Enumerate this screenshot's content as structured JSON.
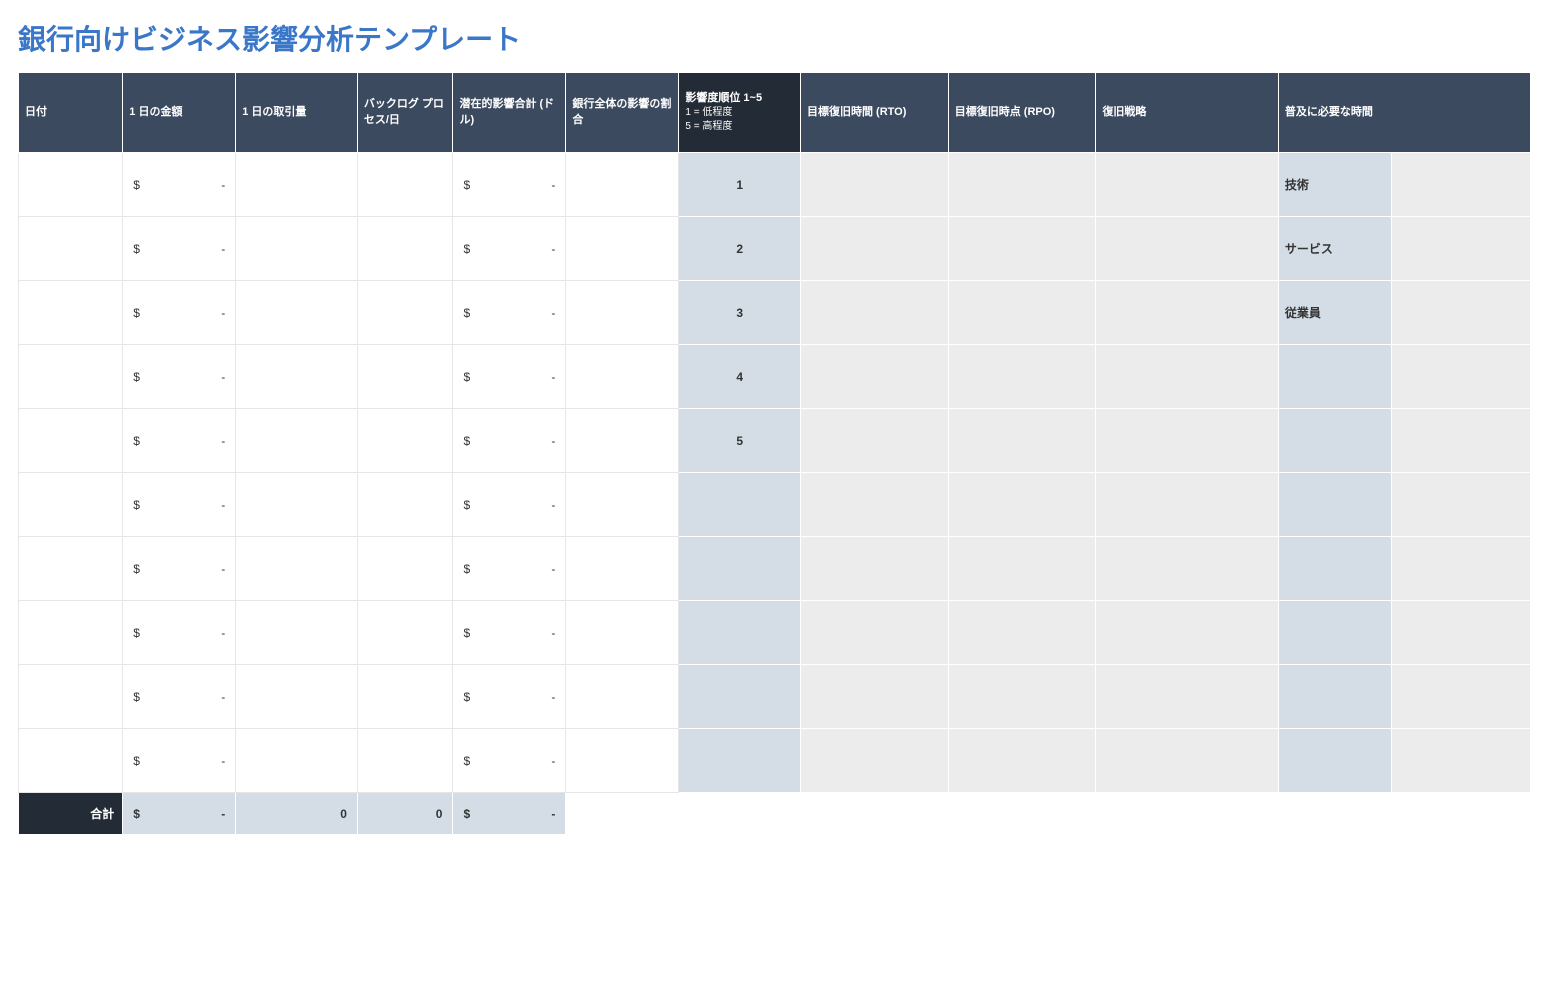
{
  "title": "銀行向けビジネス影響分析テンプレート",
  "headers": {
    "date": "日付",
    "daily_amount": "1 日の金額",
    "daily_volume": "1 日の取引量",
    "backlog": "バックログ プロセス/日",
    "potential_impact": "潜在的影響合計 (ドル)",
    "bank_impact_pct": "銀行全体の影響の割合",
    "severity_main": "影響度順位 1~5",
    "severity_sub1": "1 = 低程度",
    "severity_sub2": "5 = 高程度",
    "rto": "目標復旧時間 (RTO)",
    "rpo": "目標復旧時点 (RPO)",
    "recovery_strategy": "復旧戦略",
    "time_required": "普及に必要な時間"
  },
  "currency_symbol": "$",
  "currency_empty": "-",
  "rows": [
    {
      "sev": "1",
      "side_label": "技術"
    },
    {
      "sev": "2",
      "side_label": "サービス"
    },
    {
      "sev": "3",
      "side_label": "従業員"
    },
    {
      "sev": "4",
      "side_label": ""
    },
    {
      "sev": "5",
      "side_label": ""
    },
    {
      "sev": "",
      "side_label": ""
    },
    {
      "sev": "",
      "side_label": ""
    },
    {
      "sev": "",
      "side_label": ""
    },
    {
      "sev": "",
      "side_label": ""
    },
    {
      "sev": "",
      "side_label": ""
    }
  ],
  "totals": {
    "label": "合計",
    "volume": "0",
    "backlog": "0"
  }
}
